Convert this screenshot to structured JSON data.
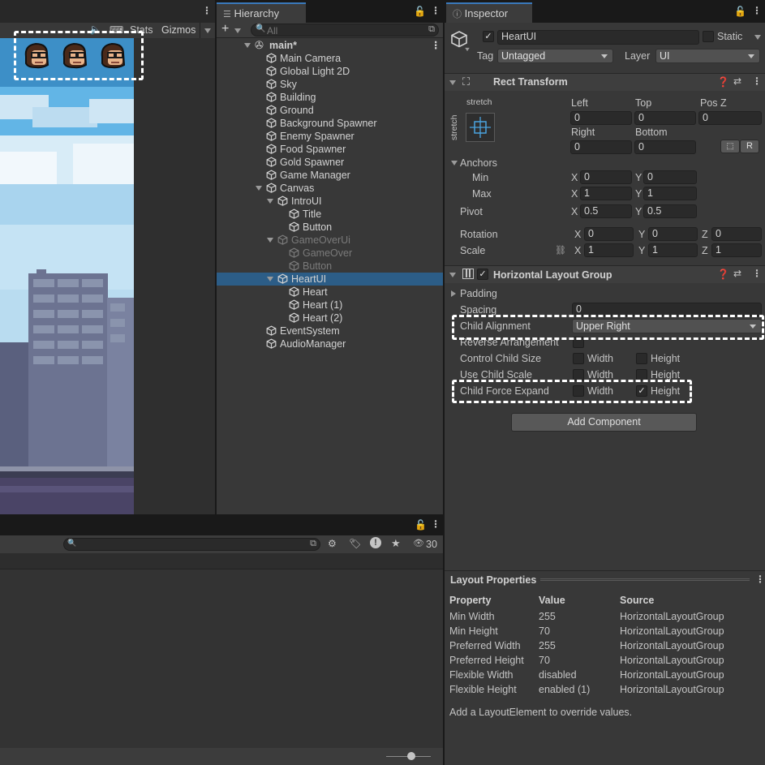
{
  "scene": {
    "stats_label": "Stats",
    "gizmos_label": "Gizmos"
  },
  "hierarchy": {
    "tab_label": "Hierarchy",
    "search_placeholder": "All",
    "scene_name": "main*",
    "items": [
      {
        "label": "Main Camera"
      },
      {
        "label": "Global Light 2D"
      },
      {
        "label": "Sky"
      },
      {
        "label": "Building"
      },
      {
        "label": "Ground"
      },
      {
        "label": "Background Spawner"
      },
      {
        "label": "Enemy Spawner"
      },
      {
        "label": "Food Spawner"
      },
      {
        "label": "Gold Spawner"
      },
      {
        "label": "Game Manager"
      },
      {
        "label": "Canvas"
      },
      {
        "label": "IntroUI"
      },
      {
        "label": "Title"
      },
      {
        "label": "Button"
      },
      {
        "label": "GameOverUi"
      },
      {
        "label": "GameOver"
      },
      {
        "label": "Button"
      },
      {
        "label": "HeartUI"
      },
      {
        "label": "Heart"
      },
      {
        "label": "Heart (1)"
      },
      {
        "label": "Heart (2)"
      },
      {
        "label": "EventSystem"
      },
      {
        "label": "AudioManager"
      }
    ]
  },
  "inspector": {
    "tab_label": "Inspector",
    "object_name": "HeartUI",
    "static_label": "Static",
    "tag_label": "Tag",
    "tag_value": "Untagged",
    "layer_label": "Layer",
    "layer_value": "UI",
    "rect_transform": {
      "title": "Rect Transform",
      "stretch_top": "stretch",
      "stretch_side": "stretch",
      "left_label": "Left",
      "left_value": "0",
      "top_label": "Top",
      "top_value": "0",
      "posz_label": "Pos Z",
      "posz_value": "0",
      "right_label": "Right",
      "right_value": "0",
      "bottom_label": "Bottom",
      "bottom_value": "0",
      "r_button": "R",
      "anchors_label": "Anchors",
      "min_label": "Min",
      "min_x": "0",
      "min_y": "0",
      "max_label": "Max",
      "max_x": "1",
      "max_y": "1",
      "pivot_label": "Pivot",
      "pivot_x": "0.5",
      "pivot_y": "0.5",
      "rotation_label": "Rotation",
      "rot_x": "0",
      "rot_y": "0",
      "rot_z": "0",
      "scale_label": "Scale",
      "scale_x": "1",
      "scale_y": "1",
      "scale_z": "1",
      "x": "X",
      "y": "Y",
      "z": "Z"
    },
    "hlg": {
      "title": "Horizontal Layout Group",
      "padding_label": "Padding",
      "spacing_label": "Spacing",
      "spacing_value": "0",
      "child_alignment_label": "Child Alignment",
      "child_alignment_value": "Upper Right",
      "reverse_label": "Reverse Arrangement",
      "control_size_label": "Control Child Size",
      "use_scale_label": "Use Child Scale",
      "force_expand_label": "Child Force Expand",
      "width": "Width",
      "height": "Height"
    },
    "add_component": "Add Component",
    "layout_properties": {
      "title": "Layout Properties",
      "headers": [
        "Property",
        "Value",
        "Source"
      ],
      "rows": [
        [
          "Min Width",
          "255",
          "HorizontalLayoutGroup"
        ],
        [
          "Min Height",
          "70",
          "HorizontalLayoutGroup"
        ],
        [
          "Preferred Width",
          "255",
          "HorizontalLayoutGroup"
        ],
        [
          "Preferred Height",
          "70",
          "HorizontalLayoutGroup"
        ],
        [
          "Flexible Width",
          "disabled",
          "HorizontalLayoutGroup"
        ],
        [
          "Flexible Height",
          "enabled (1)",
          "HorizontalLayoutGroup"
        ]
      ],
      "footer": "Add a LayoutElement to override values."
    }
  },
  "project": {
    "visible_count": "30"
  },
  "colors": {
    "selection": "#2c5d87",
    "tab_accent": "#3a79bb",
    "sky": "#5cb4e6",
    "annotation": "#ffffff"
  }
}
